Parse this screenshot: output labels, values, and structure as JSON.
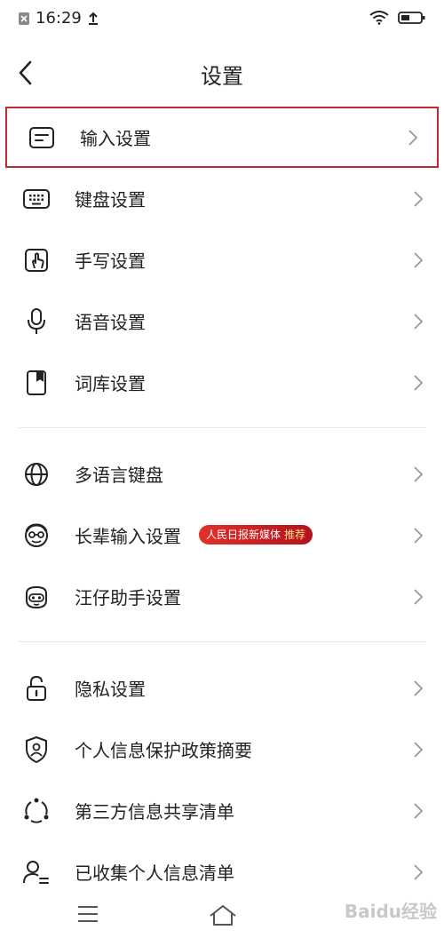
{
  "status": {
    "time": "16:29"
  },
  "header": {
    "title": "设置"
  },
  "groups": [
    {
      "items": [
        {
          "label": "输入设置",
          "icon": "text-input-icon"
        },
        {
          "label": "键盘设置",
          "icon": "keyboard-icon"
        },
        {
          "label": "手写设置",
          "icon": "handwriting-icon"
        },
        {
          "label": "语音设置",
          "icon": "microphone-icon"
        },
        {
          "label": "词库设置",
          "icon": "dictionary-icon"
        }
      ]
    },
    {
      "items": [
        {
          "label": "多语言键盘",
          "icon": "globe-icon"
        },
        {
          "label": "长辈输入设置",
          "icon": "elder-face-icon",
          "badge": {
            "text": "人民日报新媒体",
            "tag": "推荐"
          }
        },
        {
          "label": "汪仔助手设置",
          "icon": "assistant-dog-icon"
        }
      ]
    },
    {
      "items": [
        {
          "label": "隐私设置",
          "icon": "lock-icon"
        },
        {
          "label": "个人信息保护政策摘要",
          "icon": "shield-person-icon"
        },
        {
          "label": "第三方信息共享清单",
          "icon": "share-circle-icon"
        },
        {
          "label": "已收集个人信息清单",
          "icon": "person-list-icon"
        }
      ]
    }
  ],
  "watermark": "Baidu经验",
  "colors": {
    "highlight": "#c3282f",
    "badge": "#d4212a"
  }
}
